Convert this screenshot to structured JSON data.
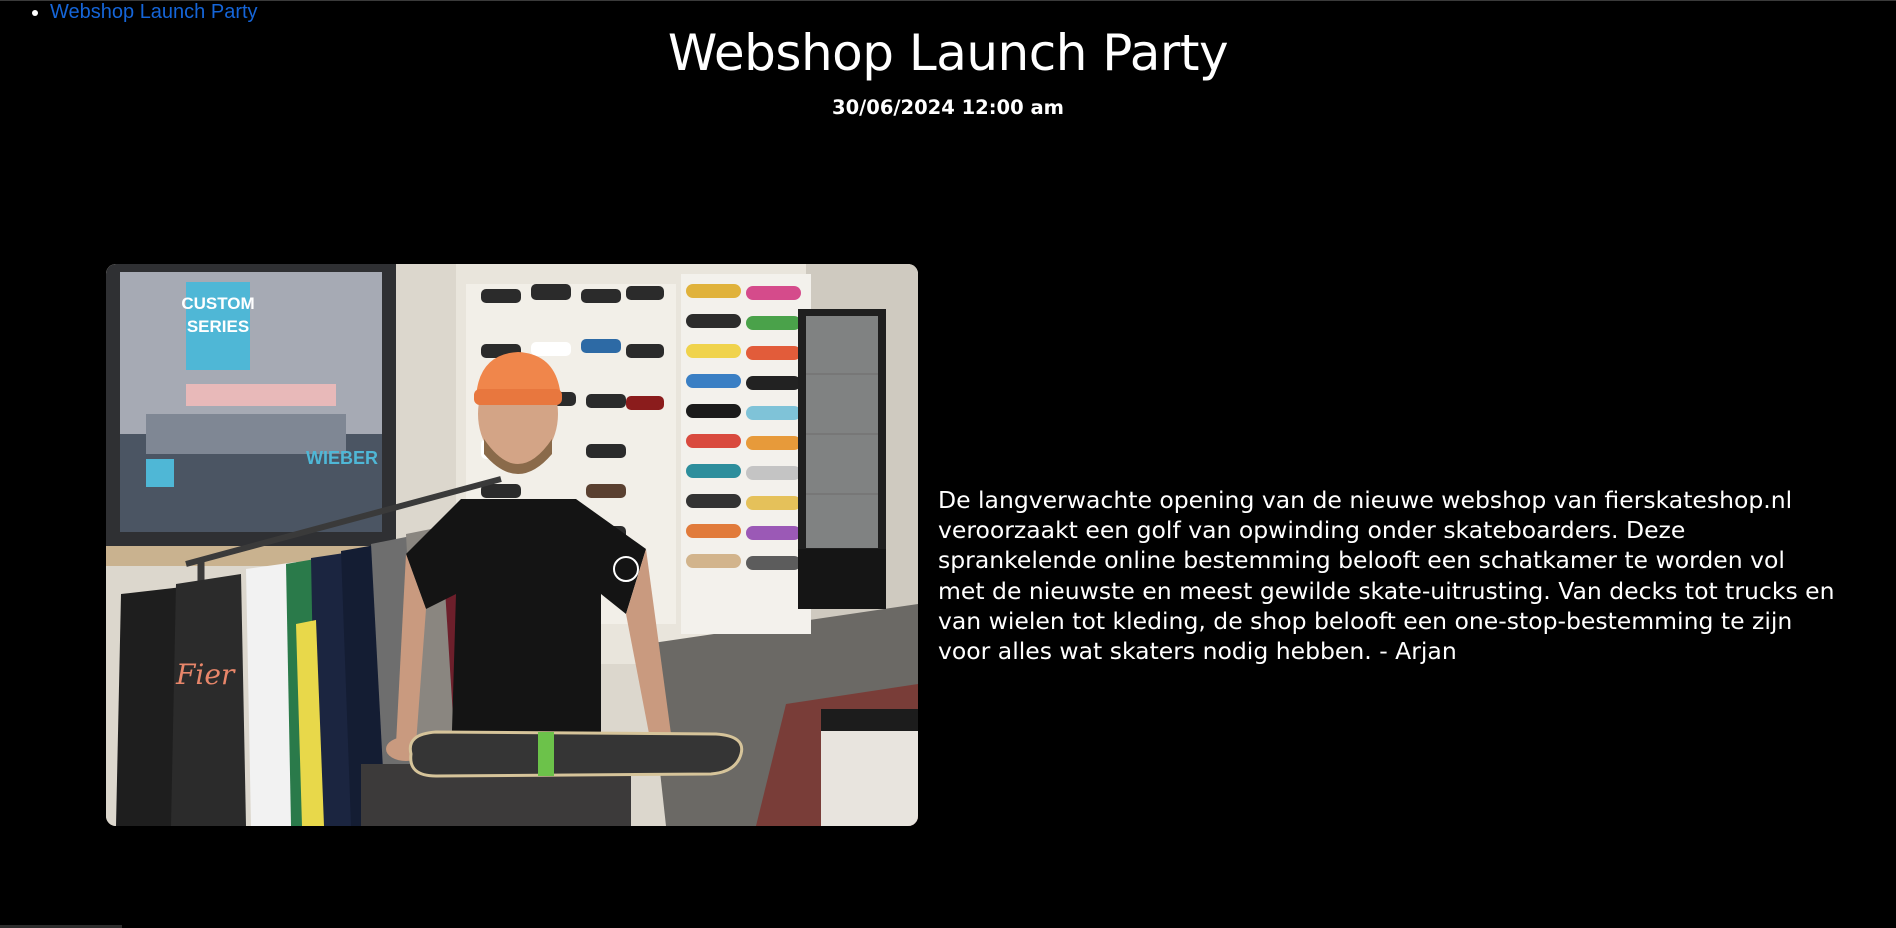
{
  "nav": {
    "items": [
      {
        "label": "Webshop Launch Party"
      }
    ]
  },
  "event": {
    "title": "Webshop Launch Party",
    "datetime": "30/06/2024 12:00 am",
    "description": "De langverwachte opening van de nieuwe webshop van fierskateshop.nl veroorzaakt een golf van opwinding onder skateboarders. Deze sprankelende online bestemming belooft een schatkamer te worden vol met de nieuwste en meest gewilde skate-uitrusting. Van decks tot trucks en van wielen tot kleding, de shop belooft een one-stop-bestemming te zijn voor alles wat skaters nodig hebben. - Arjan"
  },
  "photo": {
    "poster_text": [
      "CUSTOM",
      "SERIES"
    ],
    "poster_brand": "WIEBER",
    "shirt_text": "Fier"
  },
  "colors": {
    "background": "#000000",
    "text": "#ffffff",
    "link": "#1565d8"
  }
}
